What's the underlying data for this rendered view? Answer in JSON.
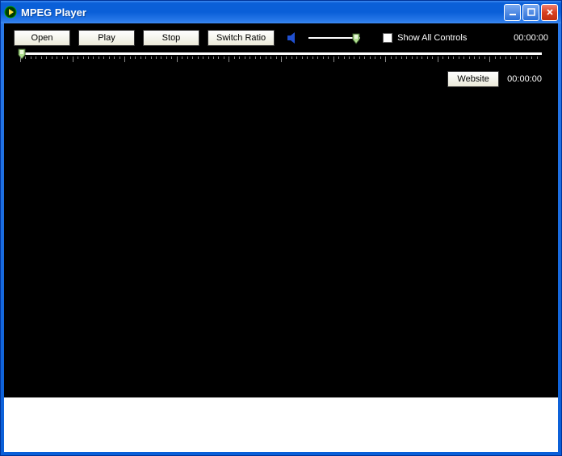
{
  "window": {
    "title": "MPEG Player"
  },
  "toolbar": {
    "open_label": "Open",
    "play_label": "Play",
    "stop_label": "Stop",
    "switch_ratio_label": "Switch Ratio",
    "show_all_label": "Show All Controls",
    "time_total": "00:00:00"
  },
  "row2": {
    "website_label": "Website",
    "time_current": "00:00:00"
  },
  "volume": {
    "value": 100,
    "max": 100
  },
  "progress": {
    "value": 0,
    "max": 100
  },
  "checkbox": {
    "show_all_checked": false
  }
}
